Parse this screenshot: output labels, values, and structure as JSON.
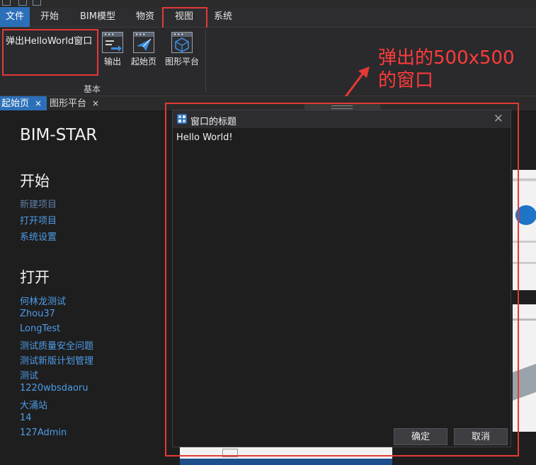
{
  "menu": {
    "items": [
      {
        "label": "文件"
      },
      {
        "label": "开始"
      },
      {
        "label": "BIM模型"
      },
      {
        "label": "物资"
      },
      {
        "label": "视图"
      },
      {
        "label": "系统"
      }
    ]
  },
  "ribbon": {
    "big_button": "弹出HelloWorld窗口",
    "tools": [
      {
        "label": "输出",
        "icon": "output-icon"
      },
      {
        "label": "起始页",
        "icon": "start-page-icon"
      },
      {
        "label": "图形平台",
        "icon": "graphics-platform-icon"
      }
    ],
    "group_label": "基本"
  },
  "annotation": {
    "text": "弹出的500x500的窗口",
    "color": "#ff3b3b"
  },
  "doc_tabs": [
    {
      "label": "起始页",
      "close": "×"
    },
    {
      "label": "图形平台",
      "close": "×"
    }
  ],
  "start_page": {
    "app_title": "BIM-STAR",
    "section_start": "开始",
    "start_links": [
      "新建项目",
      "打开项目",
      "系统设置"
    ],
    "section_open": "打开",
    "recent_projects": [
      "何林龙测试",
      "Zhou37",
      "LongTest",
      "测试质量安全问题",
      "测试新版计划管理",
      "测试",
      "1220wbsdaoru",
      "大涌站",
      "14",
      "127Admin"
    ]
  },
  "dialog": {
    "title": "窗口的标题",
    "message": "Hello World!",
    "ok_label": "确定",
    "cancel_label": "取消",
    "close_glyph": "✕"
  },
  "colors": {
    "accent": "#2c6fb9",
    "link": "#4e9ce8",
    "highlight": "#e53935"
  }
}
